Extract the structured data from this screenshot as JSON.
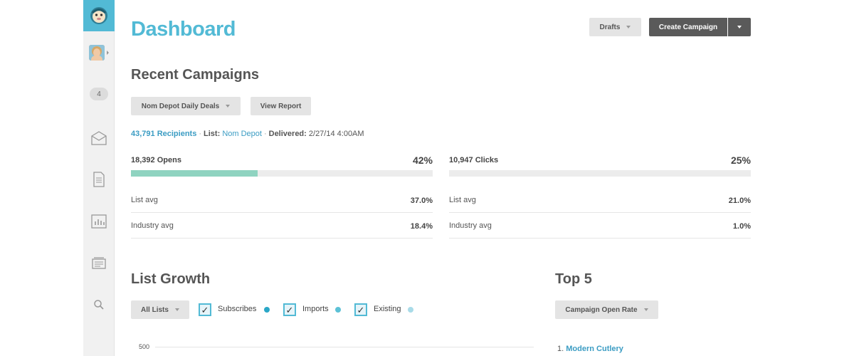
{
  "app": {
    "title": "Dashboard",
    "notification_count": "4"
  },
  "header": {
    "drafts_label": "Drafts",
    "create_label": "Create Campaign"
  },
  "recent": {
    "heading": "Recent Campaigns",
    "campaign_select": "Nom Depot Daily Deals",
    "view_report_label": "View Report",
    "recipients": "43,791 Recipients",
    "list_label": "List:",
    "list_value": "Nom Depot",
    "delivered_label": "Delivered:",
    "delivered_value": "2/27/14 4:00AM",
    "opens": {
      "label": "18,392 Opens",
      "percent": "42%",
      "fill": 0.42,
      "list_avg_label": "List avg",
      "list_avg": "37.0%",
      "industry_avg_label": "Industry avg",
      "industry_avg": "18.4%"
    },
    "clicks": {
      "label": "10,947 Clicks",
      "percent": "25%",
      "fill": 0,
      "list_avg_label": "List avg",
      "list_avg": "21.0%",
      "industry_avg_label": "Industry avg",
      "industry_avg": "1.0%"
    }
  },
  "growth": {
    "heading": "List Growth",
    "list_select": "All Lists",
    "legend": [
      {
        "label": "Subscribes",
        "color": "#2aa7c7"
      },
      {
        "label": "Imports",
        "color": "#5cc1d6"
      },
      {
        "label": "Existing",
        "color": "#a9dbe8"
      }
    ],
    "y_tick_top": "500"
  },
  "top5": {
    "heading": "Top 5",
    "metric_select": "Campaign Open Rate",
    "items": [
      {
        "rank": "1.",
        "name": "Modern Cutlery"
      }
    ]
  },
  "colors": {
    "accent": "#52bad5",
    "open_bar": "#8fd3c0",
    "link": "#3b9cc3"
  }
}
